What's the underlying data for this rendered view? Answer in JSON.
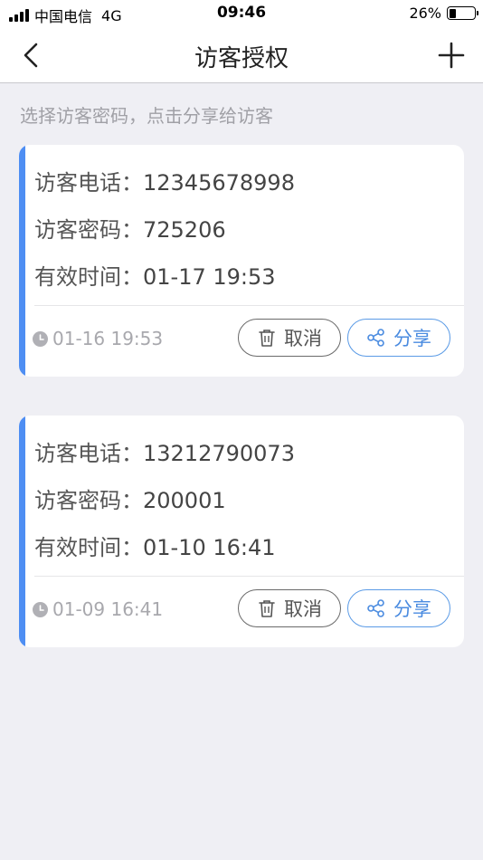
{
  "status_bar": {
    "carrier": "中国电信",
    "network": "4G",
    "time": "09:46",
    "battery": "26%",
    "battery_level": 0.26
  },
  "nav": {
    "back_icon": "chevron-left-icon",
    "title": "访客授权",
    "add_icon": "plus-icon"
  },
  "hint": "选择访客密码，点击分享给访客",
  "cards": [
    {
      "phone_label": "访客电话：",
      "phone": "12345678998",
      "code_label": "访客密码：",
      "code": "725206",
      "valid_label": "有效时间：",
      "valid": "01-17 19:53",
      "created": "01-16 19:53",
      "cancel_label": "取消",
      "share_label": "分享"
    },
    {
      "phone_label": "访客电话：",
      "phone": "13212790073",
      "code_label": "访客密码：",
      "code": "200001",
      "valid_label": "有效时间：",
      "valid": "01-10 16:41",
      "created": "01-09 16:41",
      "cancel_label": "取消",
      "share_label": "分享"
    }
  ],
  "colors": {
    "accent": "#4e8ef3",
    "share": "#4a8be0",
    "background": "#efeff4"
  }
}
